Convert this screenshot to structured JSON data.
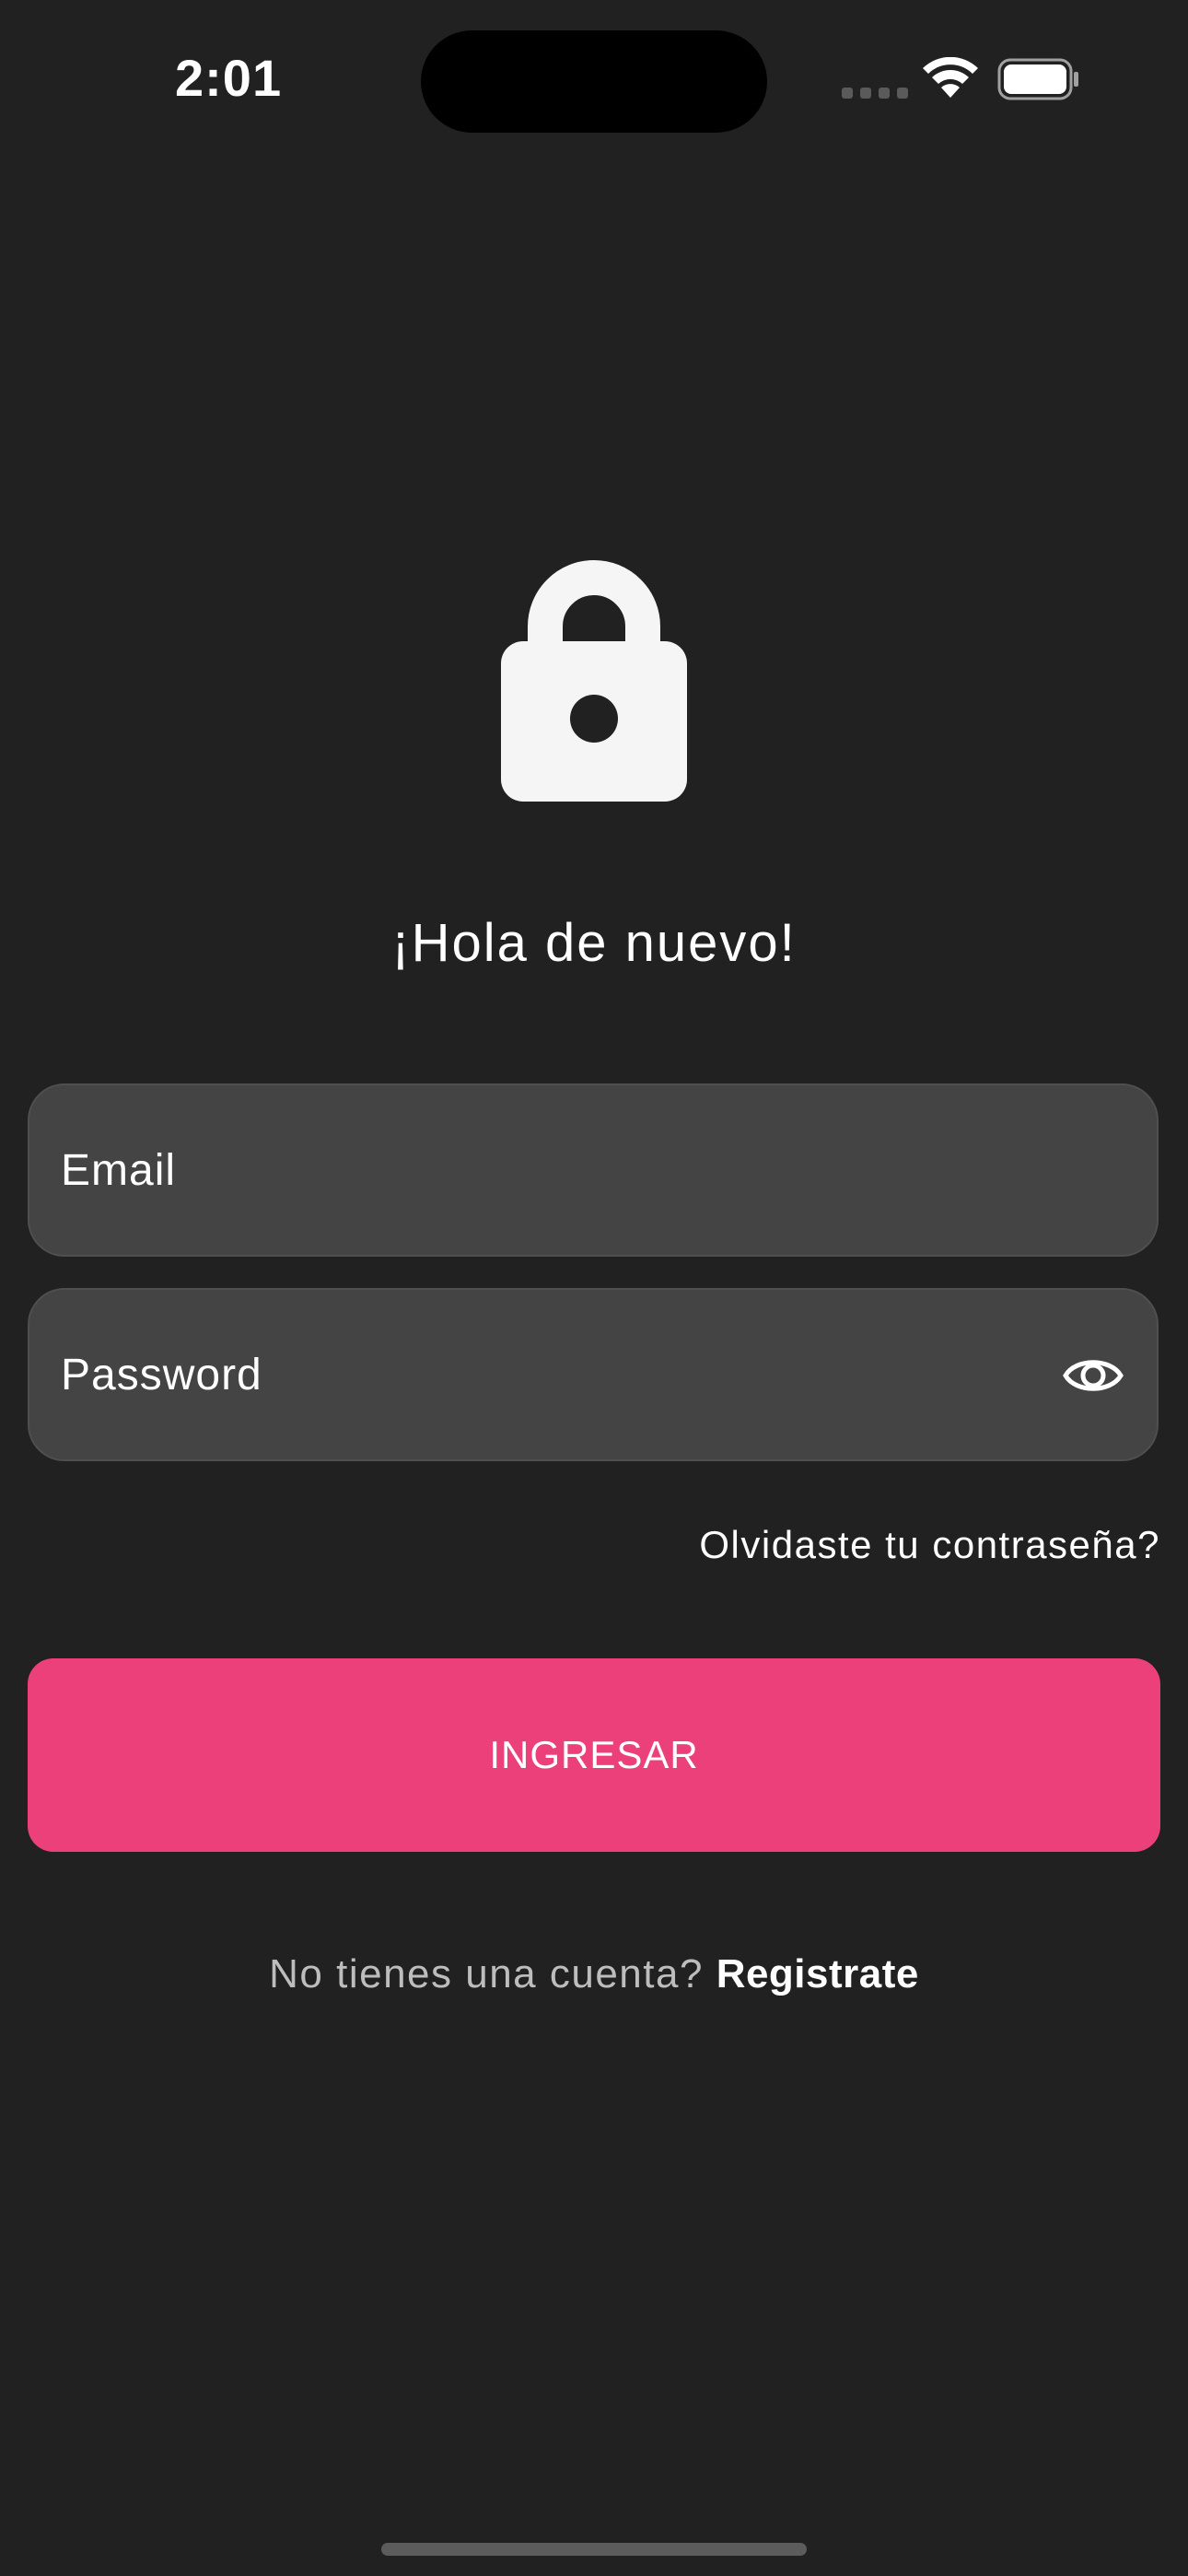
{
  "status_bar": {
    "time": "2:01"
  },
  "login": {
    "greeting": "¡Hola de nuevo!",
    "email_placeholder": "Email",
    "password_placeholder": "Password",
    "forgot_password": "Olvidaste tu contraseña?",
    "submit_label": "INGRESAR",
    "register_prompt": "No tienes una cuenta?",
    "register_link": "Registrate"
  },
  "icons": {
    "lock": "lock-icon",
    "password_toggle": "eye-icon",
    "wifi": "wifi-icon",
    "battery": "battery-icon",
    "cellular": "cellular-signal-icon"
  },
  "colors": {
    "background": "#212121",
    "field_background": "#444444",
    "accent": "#ec407a",
    "text": "#ffffff",
    "muted_text": "#bdbdbd"
  }
}
